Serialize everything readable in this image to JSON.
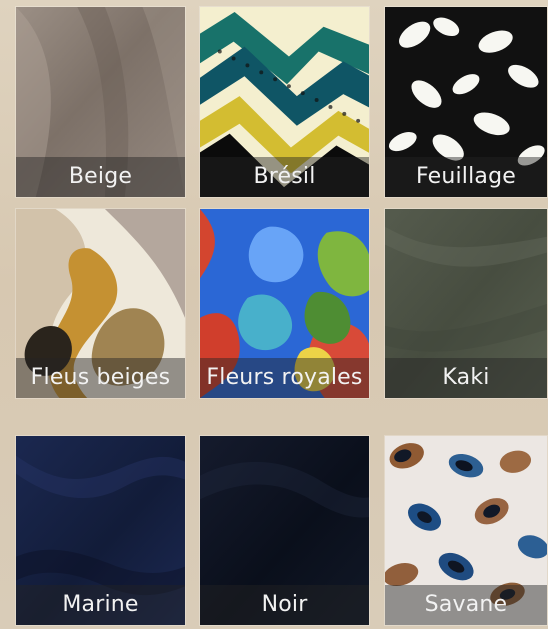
{
  "swatches": [
    {
      "label": "Beige",
      "color": "#8e8177"
    },
    {
      "label": "Brésil",
      "color": "#1d7d74"
    },
    {
      "label": "Feuillage",
      "color": "#111111"
    },
    {
      "label": "Fleus beiges",
      "color": "#c9b07f"
    },
    {
      "label": "Fleurs royales",
      "color": "#2f6fdd"
    },
    {
      "label": "Kaki",
      "color": "#4c5243"
    },
    {
      "label": "Marine",
      "color": "#162241"
    },
    {
      "label": "Noir",
      "color": "#0d1220"
    },
    {
      "label": "Savane",
      "color": "#e6e0dc"
    }
  ]
}
